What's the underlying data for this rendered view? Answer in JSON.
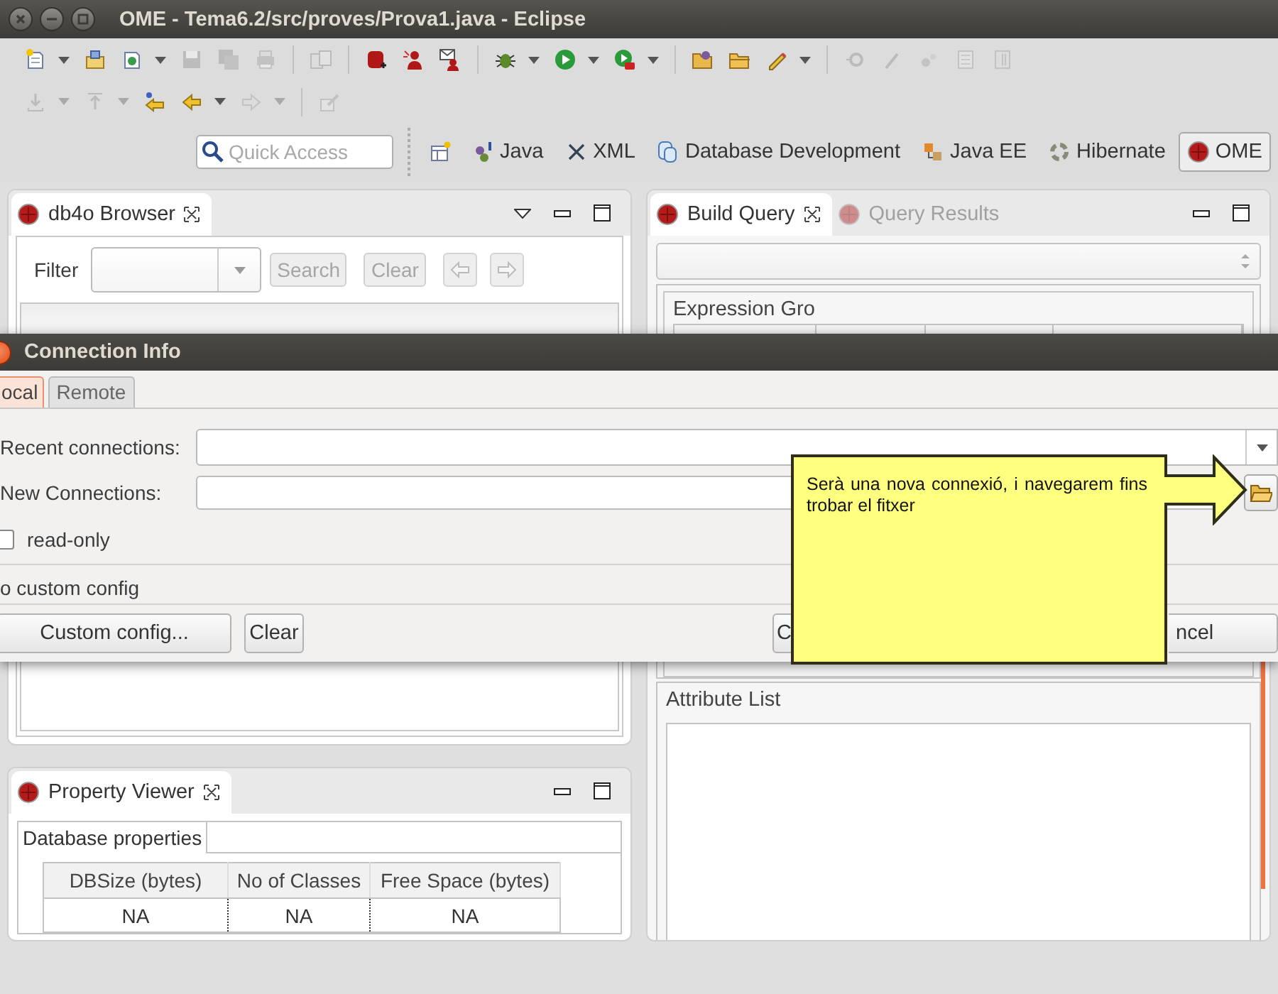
{
  "window": {
    "title": "OME - Tema6.2/src/proves/Prova1.java - Eclipse"
  },
  "toolbar_rows": [
    {
      "items": [
        {
          "kind": "button",
          "disabled": false
        },
        {
          "kind": "dropdown",
          "disabled": false
        },
        {
          "kind": "button",
          "disabled": false
        },
        {
          "kind": "button",
          "disabled": false
        },
        {
          "kind": "dropdown",
          "disabled": false
        },
        {
          "kind": "button",
          "disabled": true
        },
        {
          "kind": "button",
          "disabled": true
        },
        {
          "kind": "button",
          "disabled": true
        },
        {
          "kind": "separator"
        },
        {
          "kind": "button",
          "disabled": true
        },
        {
          "kind": "separator"
        },
        {
          "kind": "button",
          "disabled": false
        },
        {
          "kind": "button",
          "disabled": false
        },
        {
          "kind": "button",
          "disabled": false
        },
        {
          "kind": "separator"
        },
        {
          "kind": "button",
          "disabled": false
        },
        {
          "kind": "dropdown",
          "disabled": false
        },
        {
          "kind": "button",
          "disabled": false
        },
        {
          "kind": "dropdown",
          "disabled": false
        },
        {
          "kind": "button",
          "disabled": false
        },
        {
          "kind": "dropdown",
          "disabled": false
        },
        {
          "kind": "separator"
        },
        {
          "kind": "button",
          "disabled": false
        },
        {
          "kind": "button",
          "disabled": false
        },
        {
          "kind": "button",
          "disabled": false
        },
        {
          "kind": "dropdown",
          "disabled": false
        },
        {
          "kind": "separator"
        },
        {
          "kind": "button",
          "disabled": true
        },
        {
          "kind": "button",
          "disabled": true
        },
        {
          "kind": "button",
          "disabled": true
        },
        {
          "kind": "button",
          "disabled": true
        },
        {
          "kind": "button",
          "disabled": true
        }
      ]
    },
    {
      "items": [
        {
          "kind": "button",
          "disabled": true
        },
        {
          "kind": "dropdown",
          "disabled": true
        },
        {
          "kind": "button",
          "disabled": true
        },
        {
          "kind": "dropdown",
          "disabled": true
        },
        {
          "kind": "button",
          "disabled": false
        },
        {
          "kind": "button",
          "disabled": false
        },
        {
          "kind": "dropdown",
          "disabled": false
        },
        {
          "kind": "button",
          "disabled": true
        },
        {
          "kind": "dropdown",
          "disabled": true
        },
        {
          "kind": "separator"
        },
        {
          "kind": "button",
          "disabled": true
        }
      ]
    }
  ],
  "quick_access": {
    "placeholder": "Quick Access"
  },
  "perspectives": [
    {
      "label": "Java",
      "selected": false
    },
    {
      "label": "XML",
      "selected": false
    },
    {
      "label": "Database Development",
      "selected": false
    },
    {
      "label": "Java EE",
      "selected": false
    },
    {
      "label": "Hibernate",
      "selected": false
    },
    {
      "label": "OME",
      "selected": true
    }
  ],
  "db4o_browser": {
    "tabs": [
      {
        "label": "db4o Browser",
        "selected": true
      }
    ],
    "filter_label": "Filter",
    "search_button": {
      "label": "Search",
      "disabled": true
    },
    "clear_button": {
      "label": "Clear",
      "disabled": true
    },
    "back_button": {
      "disabled": true
    },
    "forward_button": {
      "disabled": true
    }
  },
  "property_viewer": {
    "tabs": [
      {
        "label": "Property Viewer",
        "selected": true
      }
    ],
    "subtabs": [
      {
        "label": "Database properties",
        "selected": true
      }
    ],
    "table": {
      "columns": [
        "DBSize (bytes)",
        "No of Classes",
        "Free Space (bytes)"
      ],
      "rows": [
        [
          "NA",
          "NA",
          "NA"
        ]
      ]
    }
  },
  "build_query": {
    "tabs": [
      {
        "label": "Build Query",
        "selected": true
      },
      {
        "label": "Query Results",
        "selected": false
      }
    ],
    "expression_group": "Expression Gro",
    "attribute_group": "Attribute List"
  },
  "dialog": {
    "title": "Connection Info",
    "tabs": [
      {
        "label": "ocal",
        "selected": true
      },
      {
        "label": "Remote",
        "selected": false
      }
    ],
    "recent_label": "Recent connections:",
    "new_label": "New Connections:",
    "read_only": {
      "label": "read-only",
      "checked": false
    },
    "status": "o custom config",
    "buttons": [
      {
        "label": "Custom config..."
      },
      {
        "label": "Clear"
      },
      {
        "label": "C"
      },
      {
        "label": "ncel"
      }
    ]
  },
  "callout": {
    "text": "Serà una nova connexió, i navegarem fins trobar el fitxer"
  }
}
